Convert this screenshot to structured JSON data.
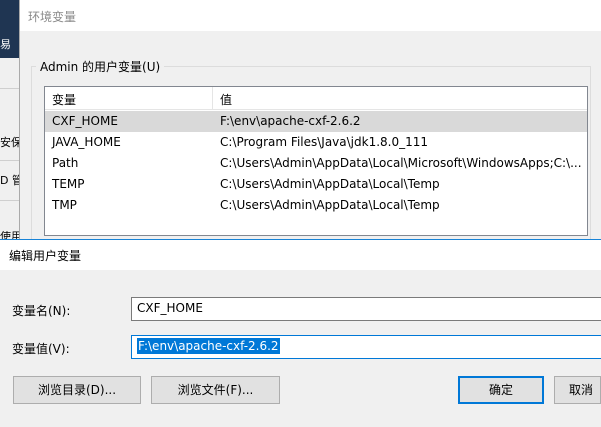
{
  "background_window": {
    "fragments": [
      "易",
      "安保护",
      "D 管",
      "使用"
    ]
  },
  "env_window": {
    "title": "环境变量",
    "user_vars_group_label": "Admin 的用户变量(U)",
    "columns": {
      "variable": "变量",
      "value": "值"
    },
    "rows": [
      {
        "name": "CXF_HOME",
        "value": "F:\\env\\apache-cxf-2.6.2",
        "selected": true
      },
      {
        "name": "JAVA_HOME",
        "value": "C:\\Program Files\\Java\\jdk1.8.0_111",
        "selected": false
      },
      {
        "name": "Path",
        "value": "C:\\Users\\Admin\\AppData\\Local\\Microsoft\\WindowsApps;C:\\...",
        "selected": false
      },
      {
        "name": "TEMP",
        "value": "C:\\Users\\Admin\\AppData\\Local\\Temp",
        "selected": false
      },
      {
        "name": "TMP",
        "value": "C:\\Users\\Admin\\AppData\\Local\\Temp",
        "selected": false
      }
    ]
  },
  "edit_dialog": {
    "title": "编辑用户变量",
    "name_label": "变量名(N):",
    "name_value": "CXF_HOME",
    "value_label": "变量值(V):",
    "value_value": "F:\\env\\apache-cxf-2.6.2",
    "buttons": {
      "browse_dir": "浏览目录(D)...",
      "browse_file": "浏览文件(F)...",
      "ok": "确定",
      "cancel": "取消"
    }
  },
  "colors": {
    "accent": "#0078d7",
    "selected_row": "#d9d9d9",
    "dialog_bg": "#f0f0f0"
  }
}
